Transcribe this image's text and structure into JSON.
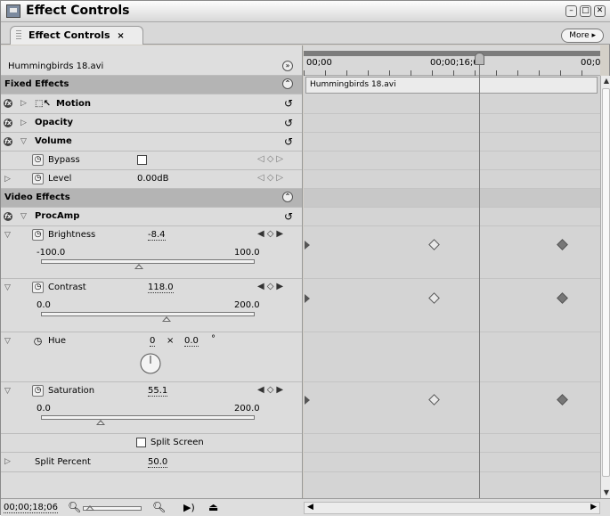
{
  "window": {
    "title": "Effect Controls",
    "tab_label": "Effect Controls",
    "tab_close": "×",
    "more_button": "More ▸"
  },
  "clip_name": "Hummingbirds 18.avi",
  "sections": {
    "fixed": "Fixed Effects",
    "video": "Video Effects"
  },
  "fixed_effects": {
    "motion": "Motion",
    "opacity": "Opacity",
    "volume": "Volume",
    "bypass": "Bypass",
    "level_label": "Level",
    "level_value": "0.00dB"
  },
  "procamp": {
    "name": "ProcAmp",
    "brightness": {
      "label": "Brightness",
      "value": "-8.4",
      "min": "-100.0",
      "max": "100.0",
      "level": 0.458
    },
    "contrast": {
      "label": "Contrast",
      "value": "118.0",
      "min": "0.0",
      "max": "200.0",
      "level": 0.59
    },
    "hue": {
      "label": "Hue",
      "rotations": "0",
      "times": "×",
      "degrees": "0.0",
      "degree_sign": "°"
    },
    "saturation": {
      "label": "Saturation",
      "value": "55.1",
      "min": "0.0",
      "max": "200.0",
      "level": 0.2755
    },
    "split_screen": "Split Screen",
    "split_percent": {
      "label": "Split Percent",
      "value": "50.0"
    }
  },
  "timeline": {
    "start": "00;00",
    "mid": "00;00;16;00",
    "end": "00;0",
    "clip_label": "Hummingbirds 18.avi"
  },
  "bottom": {
    "timecode": "00;00;18;06"
  },
  "colors": {
    "panel": "#dcdcdc",
    "section_header": "#b4b4b4",
    "timeline_bg": "#d4d4d4"
  },
  "icons": [
    "fx-icon",
    "expand-triangle-icon",
    "stopwatch-icon",
    "reset-icon",
    "keyframe-diamond-icon",
    "zoom-out-icon",
    "zoom-in-icon",
    "play-audio-icon",
    "export-icon"
  ]
}
